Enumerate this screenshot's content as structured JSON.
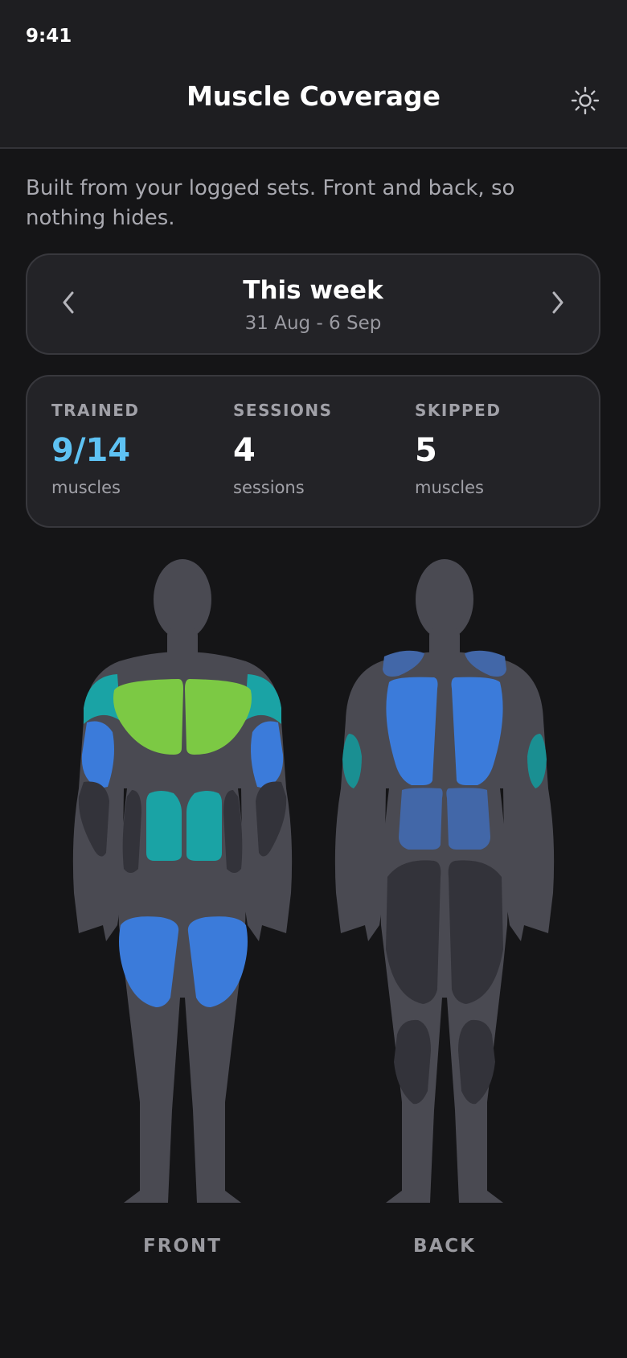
{
  "status_bar": {
    "time": "9:41"
  },
  "header": {
    "title": "Muscle Coverage",
    "settings_icon": "sun-settings-icon"
  },
  "intro": {
    "text": "Built from your logged sets. Front and back, so nothing hides."
  },
  "week_selector": {
    "title": "This week",
    "range": "31 Aug - 6 Sep",
    "prev_icon": "chevron-left-icon",
    "next_icon": "chevron-right-icon"
  },
  "stats": [
    {
      "label": "TRAINED",
      "value": "9/14",
      "sub": "muscles",
      "color": "#5ec2f3"
    },
    {
      "label": "SESSIONS",
      "value": "4",
      "sub": "sessions",
      "color": "#ffffff"
    },
    {
      "label": "SKIPPED",
      "value": "5",
      "sub": "muscles",
      "color": "#ffffff"
    }
  ],
  "body_map": {
    "front_label": "FRONT",
    "back_label": "BACK",
    "colors": {
      "body": "#4a4a52",
      "untrained": "#33333a",
      "green": "#7cc944",
      "teal": "#1aa3a5",
      "blue": "#3b7bda",
      "muted_blue": "#4267a8"
    },
    "front_muscles": [
      {
        "name": "chest",
        "level": "green"
      },
      {
        "name": "shoulders",
        "level": "teal"
      },
      {
        "name": "biceps",
        "level": "blue"
      },
      {
        "name": "forearms",
        "level": "untrained"
      },
      {
        "name": "abs",
        "level": "teal"
      },
      {
        "name": "obliques",
        "level": "untrained"
      },
      {
        "name": "quads",
        "level": "blue"
      }
    ],
    "back_muscles": [
      {
        "name": "traps",
        "level": "muted_blue"
      },
      {
        "name": "lats",
        "level": "blue"
      },
      {
        "name": "triceps",
        "level": "teal"
      },
      {
        "name": "lower-back",
        "level": "muted_blue"
      },
      {
        "name": "glutes-hamstrings",
        "level": "untrained"
      },
      {
        "name": "calves",
        "level": "untrained"
      }
    ]
  }
}
